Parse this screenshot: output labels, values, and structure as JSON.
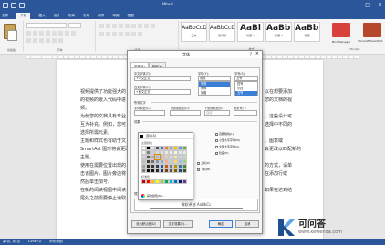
{
  "window": {
    "title": "Word"
  },
  "tabs": [
    {
      "label": "文件"
    },
    {
      "label": "开始"
    },
    {
      "label": "插入"
    },
    {
      "label": "设计"
    },
    {
      "label": "布局"
    },
    {
      "label": "引用"
    },
    {
      "label": "邮件"
    },
    {
      "label": "审阅"
    },
    {
      "label": "视图"
    }
  ],
  "ribbon": {
    "styles": [
      {
        "sample": "AaBbCcDc",
        "name": "正文"
      },
      {
        "sample": "AaBbCcDc",
        "name": "无间隔"
      },
      {
        "sample": "AaBl",
        "name": "标题 1"
      },
      {
        "sample": "AaBbC",
        "name": "标题 2"
      },
      {
        "sample": "AaBbC",
        "name": "标题"
      }
    ],
    "addins": [
      {
        "label": "MindManager",
        "color": "#d8413a"
      },
      {
        "label": "Microsoft PowerPoint",
        "color": "#b7472a"
      }
    ],
    "groups": [
      "剪贴板",
      "字体",
      "段落",
      "样式",
      "Mindjet"
    ]
  },
  "document": {
    "paragraphs": [
      {
        "left": "视频提供了功能强大的",
        "right": "以在想要添加"
      },
      {
        "left": "的视频的嵌入代码中进",
        "right": "您的文档的视"
      },
      {
        "left": "频。",
        "right": ""
      },
      {
        "left": "为使您的文档具有专业",
        "right": "。这些设计可"
      },
      {
        "left": "互为补充。例如，您可",
        "right": "选择中不同的"
      },
      {
        "left": "选择所需元素。",
        "right": ""
      },
      {
        "left": "主题和样式也有助于文",
        "right": "、图表或"
      },
      {
        "left": "SmartArt 图形将会更改",
        "right": "会更改以匹配新的"
      },
      {
        "left": "主题。",
        "right": ""
      },
      {
        "left": "使用在需要位置出现的",
        "right": "的方式，请单"
      },
      {
        "left": "击该图片，图片旁边将",
        "right": "在添加行或"
      },
      {
        "left": "然后单击加号。",
        "right": ""
      },
      {
        "left": "在新的阅读视图中阅读",
        "right": "如果在达到结"
      },
      {
        "left": "尾处之前需要停止读取",
        "right": ""
      }
    ]
  },
  "dialog": {
    "title": "字体",
    "help": "?",
    "close": "×",
    "tabs": [
      {
        "label": "字体(N)"
      },
      {
        "label": "高级(V)"
      }
    ],
    "chinese_font_label": "中文字体(T):",
    "chinese_font_value": "+中文正文",
    "western_font_label": "西文字体(F):",
    "western_font_value": "+西文正文",
    "style_label": "字形(Y):",
    "style_value": "常规",
    "style_options": [
      "常规",
      "倾斜",
      "加粗"
    ],
    "size_label": "字号(S):",
    "size_value": "五号",
    "size_options": [
      "四号",
      "小四",
      "五号"
    ],
    "all_text_label": "所有文字",
    "font_color_label": "字体颜色(C):",
    "underline_label": "下划线线型(U):",
    "underline_color_label": "下划线颜色(I):",
    "underline_color_value": "自动",
    "emphasis_label": "着重号(·):",
    "effects_label": "效果",
    "effects": [
      {
        "label": "双删除线(L)"
      },
      {
        "label": "上标(P)"
      },
      {
        "label": "下标(B)"
      },
      {
        "label": "小型大写字母(M)"
      },
      {
        "label": "全部大写字母(A)"
      },
      {
        "label": "隐藏(H)"
      }
    ],
    "preview_label": "预览",
    "preview_text": "微软卓越 AaBbCc",
    "buttons": {
      "set_default": "设为默认值(D)",
      "text_effects": "文字效果(E)...",
      "ok": "确定",
      "cancel": "取消"
    }
  },
  "palette": {
    "header": "自动(A)",
    "theme_caption": "主题颜色",
    "standard_caption": "标准色",
    "more": "其他颜色(M)...",
    "highlight_index": 23,
    "theme_colors": [
      "#ffffff",
      "#000000",
      "#e7e6e6",
      "#44546a",
      "#4472c4",
      "#ed7d31",
      "#a5a5a5",
      "#ffc000",
      "#5b9bd5",
      "#70ad47",
      "#f2f2f2",
      "#7f7f7f",
      "#d0cece",
      "#d6dce4",
      "#d9e2f3",
      "#fbe5d5",
      "#ededed",
      "#fff2cc",
      "#deebf6",
      "#e2efd9",
      "#d8d8d8",
      "#595959",
      "#aeabab",
      "#adb9ca",
      "#b4c6e7",
      "#f7cbac",
      "#dbdbdb",
      "#fee599",
      "#bdd7ee",
      "#c5e0b3",
      "#bfbfbf",
      "#3f3f3f",
      "#757070",
      "#8496b0",
      "#8eaadb",
      "#f4b183",
      "#c9c9c9",
      "#ffd965",
      "#9cc3e5",
      "#a8d08d",
      "#a5a5a5",
      "#262626",
      "#3a3838",
      "#323f4f",
      "#2f5496",
      "#c55a11",
      "#7b7b7b",
      "#bf9000",
      "#2e75b5",
      "#538135",
      "#7f7f7f",
      "#0c0c0c",
      "#171616",
      "#222a35",
      "#1f3864",
      "#833c0b",
      "#525252",
      "#7f6000",
      "#1e4e79",
      "#375623"
    ],
    "standard_colors": [
      "#c00000",
      "#ff0000",
      "#ffc000",
      "#ffff00",
      "#92d050",
      "#00b050",
      "#00b0f0",
      "#0070c0",
      "#002060",
      "#7030a0"
    ]
  },
  "statusbar": {
    "page": "第1页，共1页",
    "words": "1/232个字",
    "language": "中文(中国)"
  },
  "watermark": {
    "name": "可问答",
    "url": "www.kewenda.com"
  }
}
